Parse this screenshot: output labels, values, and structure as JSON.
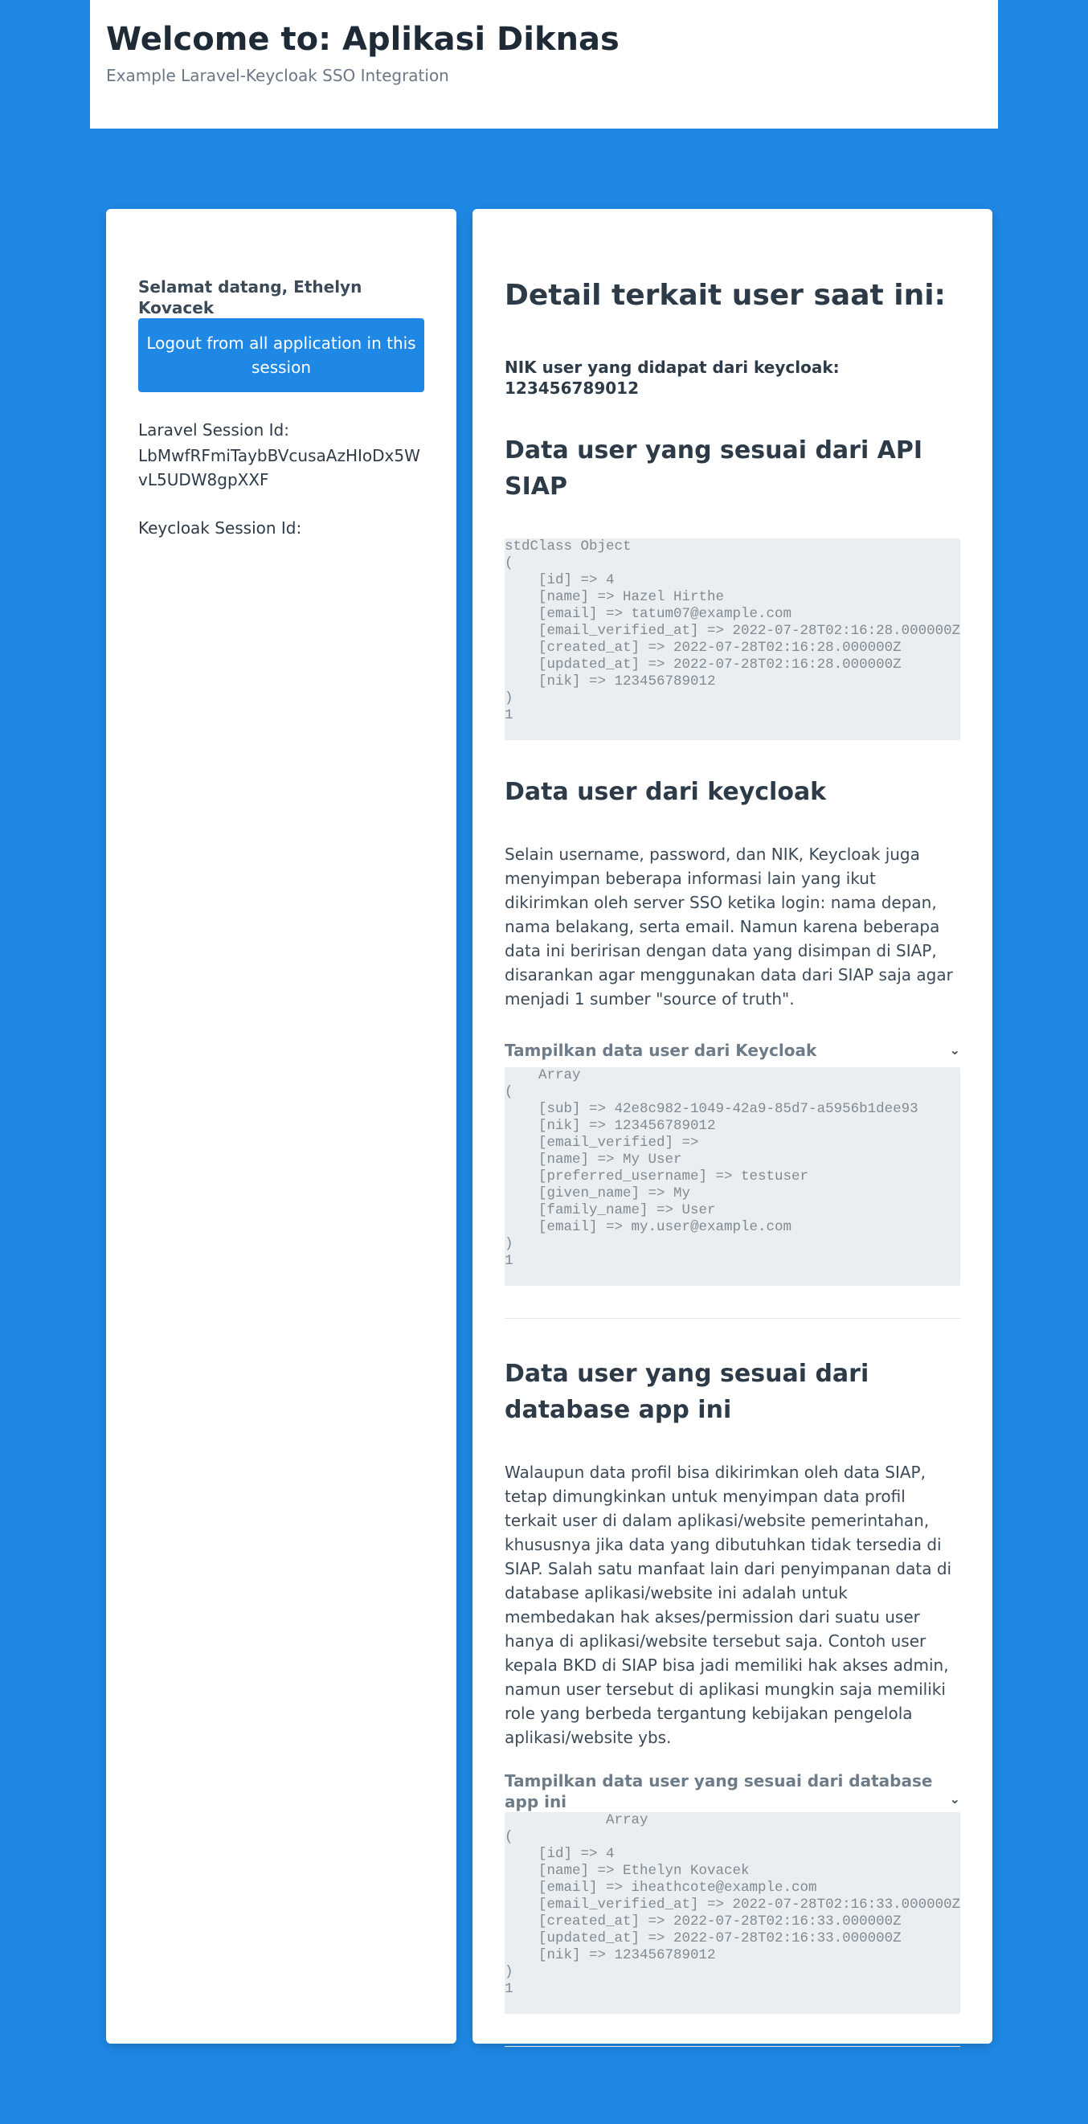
{
  "header": {
    "title": "Welcome to: Aplikasi Diknas",
    "subtitle": "Example Laravel-Keycloak SSO Integration"
  },
  "sidebar": {
    "welcome": "Selamat datang, Ethelyn Kovacek",
    "logout_label": "Logout from all application in this session",
    "laravel_session_label": "Laravel Session Id:",
    "laravel_session_value": "LbMwfRFmiTaybBVcusaAzHIoDx5WvL5UDW8gpXXF",
    "keycloak_session_label": "Keycloak Session Id:"
  },
  "main": {
    "title": "Detail terkait user saat ini:",
    "nik_line": "NIK user yang didapat dari keycloak: 123456789012",
    "siap_heading": "Data user yang sesuai dari API SIAP",
    "siap_dump": "stdClass Object\n(\n    [id] => 4\n    [name] => Hazel Hirthe\n    [email] => tatum07@example.com\n    [email_verified_at] => 2022-07-28T02:16:28.000000Z\n    [created_at] => 2022-07-28T02:16:28.000000Z\n    [updated_at] => 2022-07-28T02:16:28.000000Z\n    [nik] => 123456789012\n)\n1",
    "keycloak_heading": "Data user dari keycloak",
    "keycloak_paragraph": "Selain username, password, dan NIK, Keycloak juga menyimpan beberapa informasi lain yang ikut dikirimkan oleh server SSO ketika login: nama depan, nama belakang, serta email. Namun karena beberapa data ini beririsan dengan data yang disimpan di SIAP, disarankan agar menggunakan data dari SIAP saja agar menjadi 1 sumber \"source of truth\".",
    "keycloak_toggle": "Tampilkan data user dari Keycloak",
    "keycloak_dump": "    Array\n(\n    [sub] => 42e8c982-1049-42a9-85d7-a5956b1dee93\n    [nik] => 123456789012\n    [email_verified] => \n    [name] => My User\n    [preferred_username] => testuser\n    [given_name] => My\n    [family_name] => User\n    [email] => my.user@example.com\n)\n1",
    "db_heading": "Data user yang sesuai dari database app ini",
    "db_paragraph": "Walaupun data profil bisa dikirimkan oleh data SIAP, tetap dimungkinkan untuk menyimpan data profil terkait user di dalam aplikasi/website pemerintahan, khususnya jika data yang dibutuhkan tidak tersedia di SIAP. Salah satu manfaat lain dari penyimpanan data di database aplikasi/website ini adalah untuk membedakan hak akses/permission dari suatu user hanya di aplikasi/website tersebut saja. Contoh user kepala BKD di SIAP bisa jadi memiliki hak akses admin, namun user tersebut di aplikasi mungkin saja memiliki role yang berbeda tergantung kebijakan pengelola aplikasi/website ybs.",
    "db_toggle": "Tampilkan data user yang sesuai dari database app ini",
    "db_dump": "            Array\n(\n    [id] => 4\n    [name] => Ethelyn Kovacek\n    [email] => iheathcote@example.com\n    [email_verified_at] => 2022-07-28T02:16:33.000000Z\n    [created_at] => 2022-07-28T02:16:33.000000Z\n    [updated_at] => 2022-07-28T02:16:33.000000Z\n    [nik] => 123456789012\n)\n1"
  },
  "icons": {
    "chevron": "chevron-down-icon"
  },
  "colors": {
    "background": "#1f88e5",
    "button": "#1f88e5",
    "code_background": "#ebeef0"
  }
}
